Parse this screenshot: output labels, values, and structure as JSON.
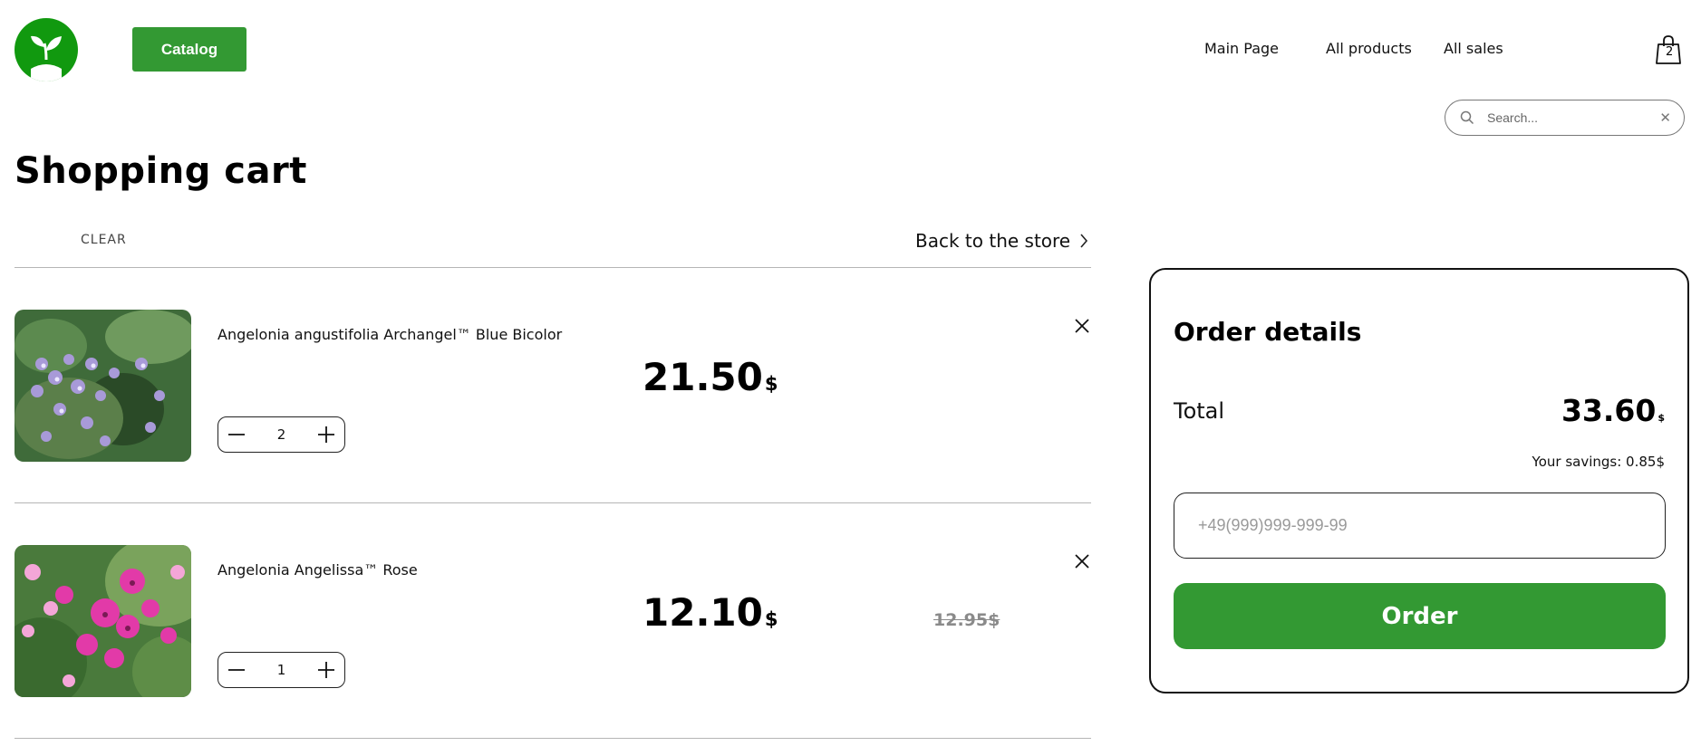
{
  "header": {
    "catalog_label": "Catalog",
    "nav": [
      {
        "label": "Main Page"
      },
      {
        "label": "All products"
      },
      {
        "label": "All sales"
      }
    ],
    "cart_count": "2",
    "search_placeholder": "Search..."
  },
  "page": {
    "title": "Shopping cart",
    "clear_label": "CLEAR",
    "back_label": "Back to the store"
  },
  "cart": {
    "items": [
      {
        "name": "Angelonia angustifolia Archangel™ Blue Bicolor",
        "price": "21.50",
        "currency": "$",
        "old_price": "",
        "quantity": "2"
      },
      {
        "name": "Angelonia Angelissa™ Rose",
        "price": "12.10",
        "currency": "$",
        "old_price": "12.95$",
        "quantity": "1"
      }
    ]
  },
  "order": {
    "title": "Order details",
    "total_label": "Total",
    "total_value": "33.60",
    "total_currency": "$",
    "savings": "Your savings: 0.85$",
    "phone_placeholder": "+49(999)999-999-99",
    "order_button": "Order"
  },
  "colors": {
    "brand_green": "#339933",
    "logo_green": "#11990f"
  },
  "icons": [
    "plant-logo",
    "cart-bag-icon",
    "search-icon",
    "close-icon",
    "chevron-right-icon",
    "minus-icon",
    "plus-icon"
  ]
}
